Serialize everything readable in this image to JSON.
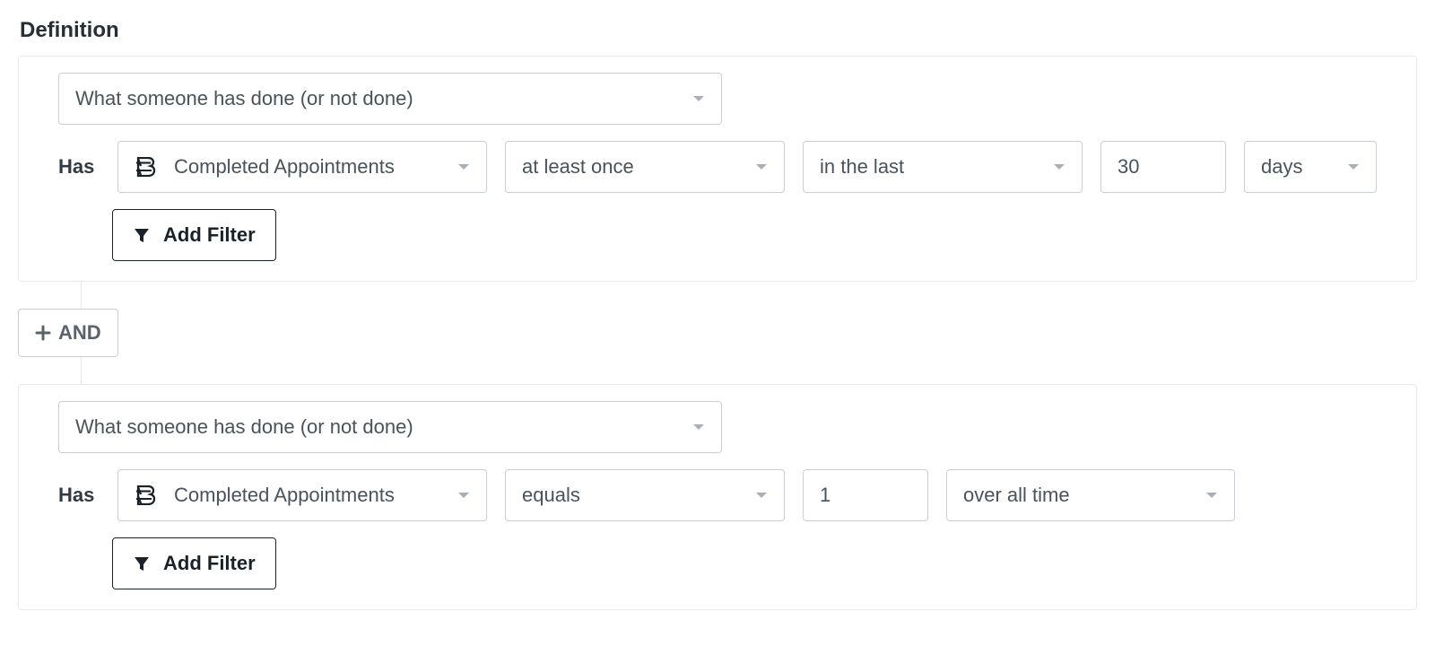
{
  "section_title": "Definition",
  "colors": {
    "border": "#c9ced3",
    "card_border": "#e6e8ea",
    "text": "#4a525a",
    "strong": "#1b2128"
  },
  "rules": [
    {
      "type_select": "What someone has done (or not done)",
      "has_label": "Has",
      "metric": "Completed Appointments",
      "frequency": "at least once",
      "range": "in the last",
      "number": "30",
      "unit": "days",
      "add_filter_label": "Add Filter"
    },
    {
      "type_select": "What someone has done (or not done)",
      "has_label": "Has",
      "metric": "Completed Appointments",
      "frequency": "equals",
      "number": "1",
      "range": "over all time",
      "add_filter_label": "Add Filter"
    }
  ],
  "and_chip": {
    "label": "AND"
  },
  "icons": {
    "metric_icon_name": "appointment-b-icon",
    "funnel_icon_name": "filter-icon",
    "plus_icon_name": "plus-icon",
    "chevron_icon_name": "chevron-down-icon"
  }
}
